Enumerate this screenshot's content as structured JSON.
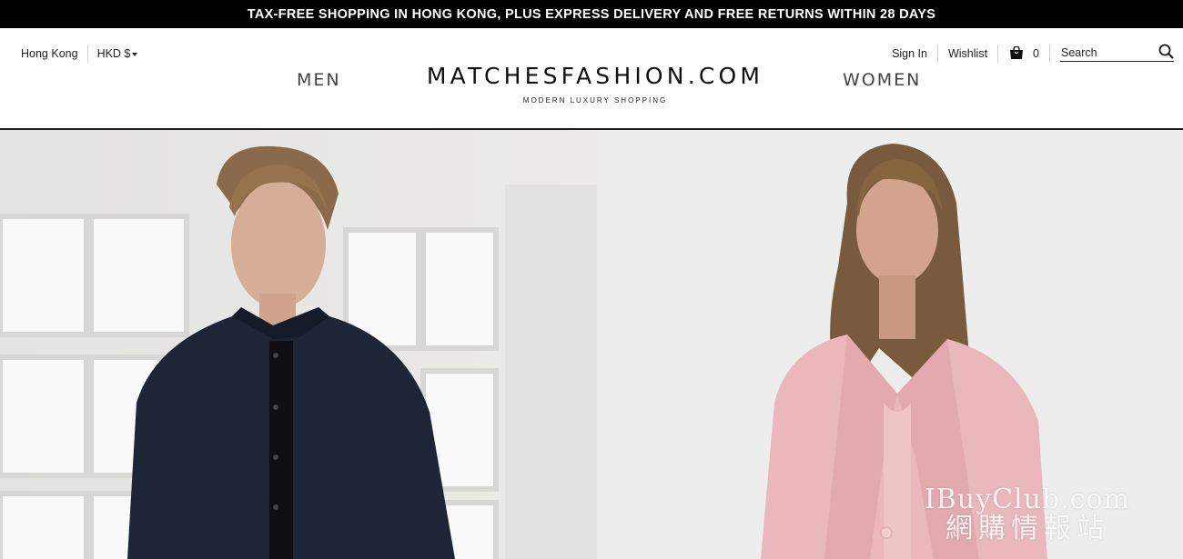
{
  "promo": {
    "text": "TAX-FREE SHOPPING IN HONG KONG, PLUS EXPRESS DELIVERY AND FREE RETURNS WITHIN 28 DAYS"
  },
  "header": {
    "country": "Hong Kong",
    "currency": "HKD $",
    "sign_in": "Sign In",
    "wishlist": "Wishlist",
    "bag_count": "0",
    "search_placeholder": "Search",
    "nav_men": "MEN",
    "nav_women": "WOMEN",
    "logo": "MATCHESFASHION.COM",
    "tagline": "MODERN LUXURY SHOPPING"
  },
  "hero": {
    "watermark_line1": "IBuyClub.com",
    "watermark_line2": "網購情報站"
  },
  "colors": {
    "promo_bg": "#000000",
    "text": "#222222",
    "men_jacket": "#1e2536",
    "women_coat": "#eab8bc"
  },
  "icons": [
    "caret-down-icon",
    "shopping-bag-icon",
    "search-icon"
  ]
}
